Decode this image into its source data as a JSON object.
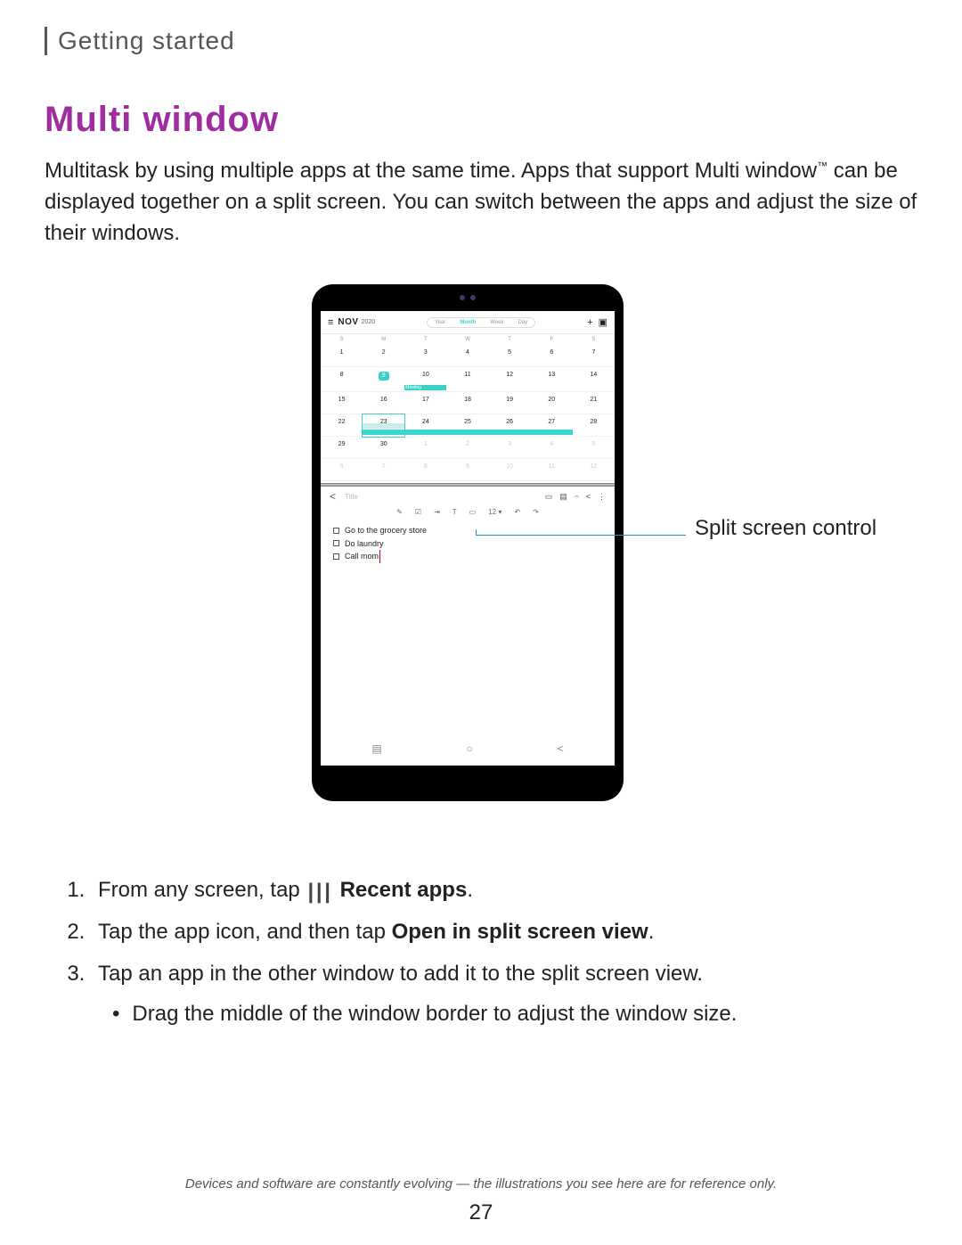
{
  "header": {
    "section": "Getting started"
  },
  "title": "Multi window",
  "intro": {
    "part1": "Multitask by using multiple apps at the same time. Apps that support Multi window",
    "tm": "™",
    "part2": " can be displayed together on a split screen. You can switch between the apps and adjust the size of their windows."
  },
  "figure": {
    "callout": "Split screen control",
    "calendar": {
      "month": "NOV",
      "year": "2020",
      "views": [
        "Year",
        "Month",
        "Week",
        "Day"
      ],
      "active_view": "Month",
      "plus": "+",
      "today_icon": "▢",
      "dow": [
        "S",
        "M",
        "T",
        "W",
        "T",
        "F",
        "S"
      ],
      "weeks": [
        [
          "1",
          "2",
          "3",
          "4",
          "5",
          "6",
          "7"
        ],
        [
          "8",
          "9",
          "10",
          "11",
          "12",
          "13",
          "14"
        ],
        [
          "15",
          "16",
          "17",
          "18",
          "19",
          "20",
          "21"
        ],
        [
          "22",
          "23",
          "24",
          "25",
          "26",
          "27",
          "28"
        ],
        [
          "29",
          "30",
          "1",
          "2",
          "3",
          "4",
          "5"
        ],
        [
          "6",
          "7",
          "8",
          "9",
          "10",
          "11",
          "12"
        ]
      ],
      "today_cell": "9",
      "meeting_label": "Meeting",
      "selected": "23"
    },
    "notes": {
      "title_placeholder": "Title",
      "icons": [
        "▭",
        "▤",
        "𝄐",
        "<",
        "⋮"
      ],
      "toolbar": [
        "✎",
        "☑",
        "⇥",
        "T",
        "▭",
        "12 ▾",
        "↶",
        "↷"
      ],
      "todos": [
        "Go to the grocery store",
        "Do laundry",
        "Call mom"
      ]
    },
    "nav": [
      "▤",
      "○",
      "<"
    ]
  },
  "steps": {
    "s1a": "From any screen, tap",
    "s1_icon": "| | |",
    "s1_bold": "Recent apps",
    "s1_end": ".",
    "s2a": "Tap the app icon, and then tap ",
    "s2_bold": "Open in split screen view",
    "s2_end": ".",
    "s3": "Tap an app in the other window to add it to the split screen view.",
    "s3_sub": "Drag the middle of the window border to adjust the window size."
  },
  "footer": "Devices and software are constantly evolving — the illustrations you see here are for reference only.",
  "page": "27"
}
